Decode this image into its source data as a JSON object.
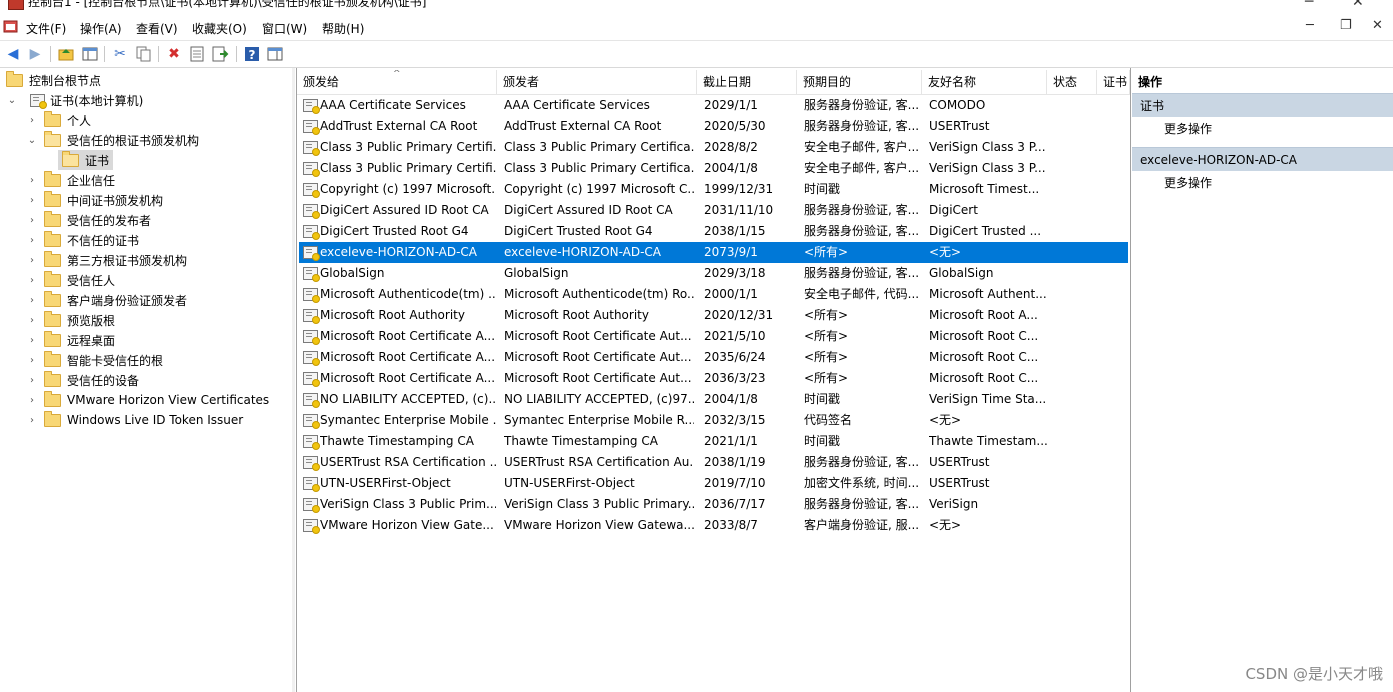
{
  "title_bar": {
    "text": "控制台1 - [控制台根节点\\证书(本地计算机)\\受信任的根证书颁发机构\\证书]"
  },
  "menu": [
    "文件(F)",
    "操作(A)",
    "查看(V)",
    "收藏夹(O)",
    "窗口(W)",
    "帮助(H)"
  ],
  "tree": {
    "root": "控制台根节点",
    "computer": "证书(本地计算机)",
    "personal": "个人",
    "trusted_root": "受信任的根证书颁发机构",
    "certs_leaf": "证书",
    "others": [
      "企业信任",
      "中间证书颁发机构",
      "受信任的发布者",
      "不信任的证书",
      "第三方根证书颁发机构",
      "受信任人",
      "客户端身份验证颁发者",
      "预览版根",
      "远程桌面",
      "智能卡受信任的根",
      "受信任的设备",
      "VMware Horizon View Certificates",
      "Windows Live ID Token Issuer"
    ]
  },
  "columns": [
    "颁发给",
    "颁发者",
    "截止日期",
    "预期目的",
    "友好名称",
    "状态",
    "证书"
  ],
  "rows": [
    {
      "to": "AAA Certificate Services",
      "by": "AAA Certificate Services",
      "exp": "2029/1/1",
      "purpose": "服务器身份验证, 客...",
      "name": "COMODO"
    },
    {
      "to": "AddTrust External CA Root",
      "by": "AddTrust External CA Root",
      "exp": "2020/5/30",
      "purpose": "服务器身份验证, 客...",
      "name": "USERTrust"
    },
    {
      "to": "Class 3 Public Primary Certifi...",
      "by": "Class 3 Public Primary Certifica...",
      "exp": "2028/8/2",
      "purpose": "安全电子邮件, 客户...",
      "name": "VeriSign Class 3 P..."
    },
    {
      "to": "Class 3 Public Primary Certifi...",
      "by": "Class 3 Public Primary Certifica...",
      "exp": "2004/1/8",
      "purpose": "安全电子邮件, 客户...",
      "name": "VeriSign Class 3 P..."
    },
    {
      "to": "Copyright (c) 1997 Microsoft...",
      "by": "Copyright (c) 1997 Microsoft C...",
      "exp": "1999/12/31",
      "purpose": "时间戳",
      "name": "Microsoft Timest..."
    },
    {
      "to": "DigiCert Assured ID Root CA",
      "by": "DigiCert Assured ID Root CA",
      "exp": "2031/11/10",
      "purpose": "服务器身份验证, 客...",
      "name": "DigiCert"
    },
    {
      "to": "DigiCert Trusted Root G4",
      "by": "DigiCert Trusted Root G4",
      "exp": "2038/1/15",
      "purpose": "服务器身份验证, 客...",
      "name": "DigiCert Trusted ..."
    },
    {
      "to": "exceleve-HORIZON-AD-CA",
      "by": "exceleve-HORIZON-AD-CA",
      "exp": "2073/9/1",
      "purpose": "<所有>",
      "name": "<无>",
      "selected": true
    },
    {
      "to": "GlobalSign",
      "by": "GlobalSign",
      "exp": "2029/3/18",
      "purpose": "服务器身份验证, 客...",
      "name": "GlobalSign"
    },
    {
      "to": "Microsoft Authenticode(tm) ...",
      "by": "Microsoft Authenticode(tm) Ro...",
      "exp": "2000/1/1",
      "purpose": "安全电子邮件, 代码...",
      "name": "Microsoft Authent..."
    },
    {
      "to": "Microsoft Root Authority",
      "by": "Microsoft Root Authority",
      "exp": "2020/12/31",
      "purpose": "<所有>",
      "name": "Microsoft Root A..."
    },
    {
      "to": "Microsoft Root Certificate A...",
      "by": "Microsoft Root Certificate Aut...",
      "exp": "2021/5/10",
      "purpose": "<所有>",
      "name": "Microsoft Root C..."
    },
    {
      "to": "Microsoft Root Certificate A...",
      "by": "Microsoft Root Certificate Aut...",
      "exp": "2035/6/24",
      "purpose": "<所有>",
      "name": "Microsoft Root C..."
    },
    {
      "to": "Microsoft Root Certificate A...",
      "by": "Microsoft Root Certificate Aut...",
      "exp": "2036/3/23",
      "purpose": "<所有>",
      "name": "Microsoft Root C..."
    },
    {
      "to": "NO LIABILITY ACCEPTED, (c)...",
      "by": "NO LIABILITY ACCEPTED, (c)97...",
      "exp": "2004/1/8",
      "purpose": "时间戳",
      "name": "VeriSign Time Sta..."
    },
    {
      "to": "Symantec Enterprise Mobile ...",
      "by": "Symantec Enterprise Mobile R...",
      "exp": "2032/3/15",
      "purpose": "代码签名",
      "name": "<无>"
    },
    {
      "to": "Thawte Timestamping CA",
      "by": "Thawte Timestamping CA",
      "exp": "2021/1/1",
      "purpose": "时间戳",
      "name": "Thawte Timestam..."
    },
    {
      "to": "USERTrust RSA Certification ...",
      "by": "USERTrust RSA Certification Au...",
      "exp": "2038/1/19",
      "purpose": "服务器身份验证, 客...",
      "name": "USERTrust"
    },
    {
      "to": "UTN-USERFirst-Object",
      "by": "UTN-USERFirst-Object",
      "exp": "2019/7/10",
      "purpose": "加密文件系统, 时间...",
      "name": "USERTrust"
    },
    {
      "to": "VeriSign Class 3 Public Prim...",
      "by": "VeriSign Class 3 Public Primary...",
      "exp": "2036/7/17",
      "purpose": "服务器身份验证, 客...",
      "name": "VeriSign"
    },
    {
      "to": "VMware Horizon View Gate...",
      "by": "VMware Horizon View Gatewa...",
      "exp": "2033/8/7",
      "purpose": "客户端身份验证, 服...",
      "name": "<无>"
    }
  ],
  "actions": {
    "title": "操作",
    "section1": "证书",
    "section1_item": "更多操作",
    "section2": "exceleve-HORIZON-AD-CA",
    "section2_item": "更多操作"
  },
  "watermark": "CSDN @是小天才哦",
  "colors": {
    "selection": "#0078d7",
    "action_section": "#c9d6e3"
  }
}
